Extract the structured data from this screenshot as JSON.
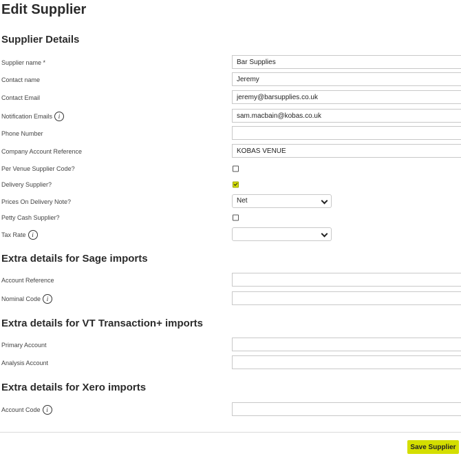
{
  "page": {
    "title": "Edit Supplier"
  },
  "sections": {
    "supplier_details": "Supplier Details",
    "sage": "Extra details for Sage imports",
    "vt": "Extra details for VT Transaction+ imports",
    "xero": "Extra details for Xero imports"
  },
  "fields": {
    "supplier_name": {
      "label": "Supplier name *",
      "value": "Bar Supplies"
    },
    "contact_name": {
      "label": "Contact name",
      "value": "Jeremy"
    },
    "contact_email": {
      "label": "Contact Email",
      "value": "jeremy@barsupplies.co.uk"
    },
    "notification_emails": {
      "label": "Notification Emails",
      "value": "sam.macbain@kobas.co.uk"
    },
    "phone_number": {
      "label": "Phone Number",
      "value": ""
    },
    "company_account_reference": {
      "label": "Company Account Reference",
      "value": "KOBAS VENUE"
    },
    "per_venue_supplier_code": {
      "label": "Per Venue Supplier Code?",
      "checked": false
    },
    "delivery_supplier": {
      "label": "Delivery Supplier?",
      "checked": true
    },
    "prices_on_delivery_note": {
      "label": "Prices On Delivery Note?",
      "value": "Net"
    },
    "petty_cash_supplier": {
      "label": "Petty Cash Supplier?",
      "checked": false
    },
    "tax_rate": {
      "label": "Tax Rate",
      "value": ""
    },
    "account_reference": {
      "label": "Account Reference",
      "value": ""
    },
    "nominal_code": {
      "label": "Nominal Code",
      "value": ""
    },
    "primary_account": {
      "label": "Primary Account",
      "value": ""
    },
    "analysis_account": {
      "label": "Analysis Account",
      "value": ""
    },
    "account_code": {
      "label": "Account Code",
      "value": ""
    }
  },
  "icons": {
    "info_glyph": "i"
  },
  "actions": {
    "save_label": "Save Supplier"
  },
  "colors": {
    "accent": "#d4de00"
  }
}
